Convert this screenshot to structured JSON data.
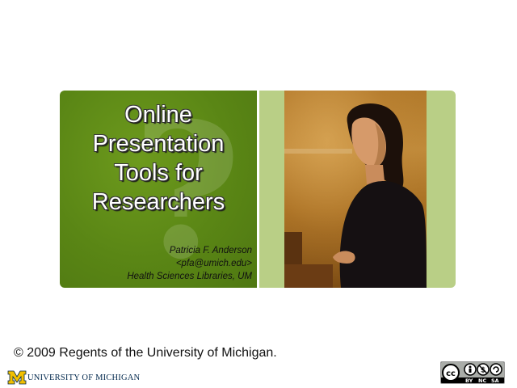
{
  "slide": {
    "title_lines": [
      "Online",
      "Presentation",
      "Tools for",
      "Researchers"
    ],
    "author": {
      "name": "Patricia F. Anderson",
      "email": "<pfa@umich.edu>",
      "affiliation": "Health Sciences Libraries, UM"
    },
    "copyright": "© 2009 Regents of the University of Michigan.",
    "logo": {
      "text": "UNIVERSITY OF MICHIGAN",
      "icon": "block-m-logo"
    },
    "license_badge": {
      "icon": "cc-by-nc-sa-badge",
      "labels": [
        "BY",
        "NC",
        "SA"
      ]
    }
  },
  "colors": {
    "green_panel": "#5a8615",
    "light_green": "#b9cf86",
    "umich_maize": "#f2c000",
    "umich_blue": "#00274c"
  },
  "photo": {
    "icon": "presenter-photo"
  }
}
